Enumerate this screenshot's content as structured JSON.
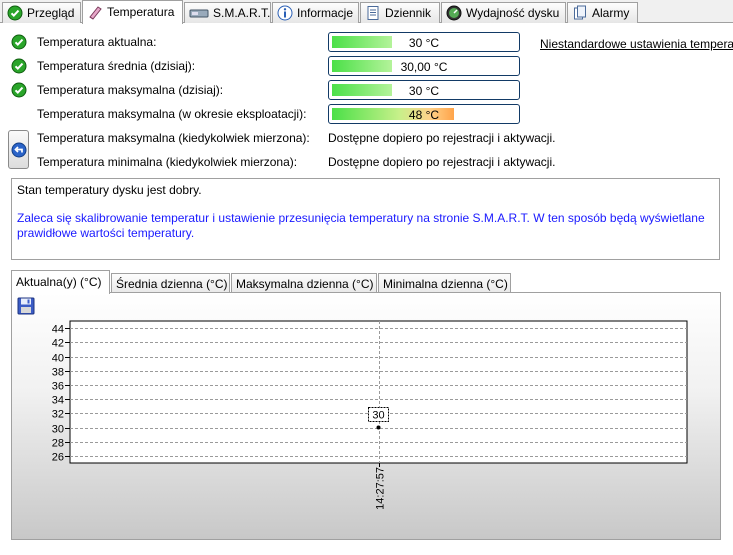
{
  "tabs": [
    {
      "label": "Przegląd",
      "icon": "ok-check-icon"
    },
    {
      "label": "Temperatura",
      "icon": "thermometer-icon"
    },
    {
      "label": "S.M.A.R.T.",
      "icon": "smart-drive-icon"
    },
    {
      "label": "Informacje",
      "icon": "info-icon"
    },
    {
      "label": "Dziennik",
      "icon": "log-document-icon"
    },
    {
      "label": "Wydajność dysku",
      "icon": "speedometer-icon"
    },
    {
      "label": "Alarmy",
      "icon": "alarm-document-icon"
    }
  ],
  "temps": {
    "current_label": "Temperatura aktualna:",
    "current_value": "30 °C",
    "current_level": 0.33,
    "avg_label": "Temperatura średnia (dzisiaj):",
    "avg_value": "30,00 °C",
    "avg_level": 0.33,
    "max_today_label": "Temperatura maksymalna (dzisiaj):",
    "max_today_value": "30 °C",
    "max_today_level": 0.33,
    "max_life_label": "Temperatura maksymalna (w okresie eksploatacji):",
    "max_life_value": "48 °C",
    "max_life_level": 0.66,
    "max_ever_label": "Temperatura maksymalna (kiedykolwiek mierzona):",
    "max_ever_value": "Dostępne dopiero po rejestracji i aktywacji.",
    "min_ever_label": "Temperatura minimalna (kiedykolwiek mierzona):",
    "min_ever_value": "Dostępne dopiero po rejestracji i aktywacji.",
    "custom_link": "Niestandardowe ustawienia tempera"
  },
  "message": {
    "status": "Stan temperatury dysku jest dobry.",
    "advice": "Zaleca się skalibrowanie temperatur i ustawienie przesunięcia temperatury na stronie S.M.A.R.T. W ten sposób będą wyświetlane prawidłowe wartości temperatury."
  },
  "chart_tabs": [
    "Aktualna(y) (°C)",
    "Średnia dzienna (°C)",
    "Maksymalna dzienna (°C)",
    "Minimalna dzienna (°C)"
  ],
  "colors": {
    "status_ok": "#2aa52a",
    "advice_text": "#1a1aff",
    "bar_green": "#4be048",
    "bar_hot": "#ffa44a"
  },
  "chart_data": {
    "type": "line",
    "title": "",
    "xlabel": "",
    "ylabel": "",
    "x": [
      "14:27:57"
    ],
    "series": [
      {
        "values": [
          30
        ]
      }
    ],
    "data_labels": [
      "30"
    ],
    "yticks": [
      26,
      28,
      30,
      32,
      34,
      36,
      38,
      40,
      42,
      44
    ],
    "ylim": [
      25,
      45
    ],
    "grid": true,
    "legend": "none"
  }
}
